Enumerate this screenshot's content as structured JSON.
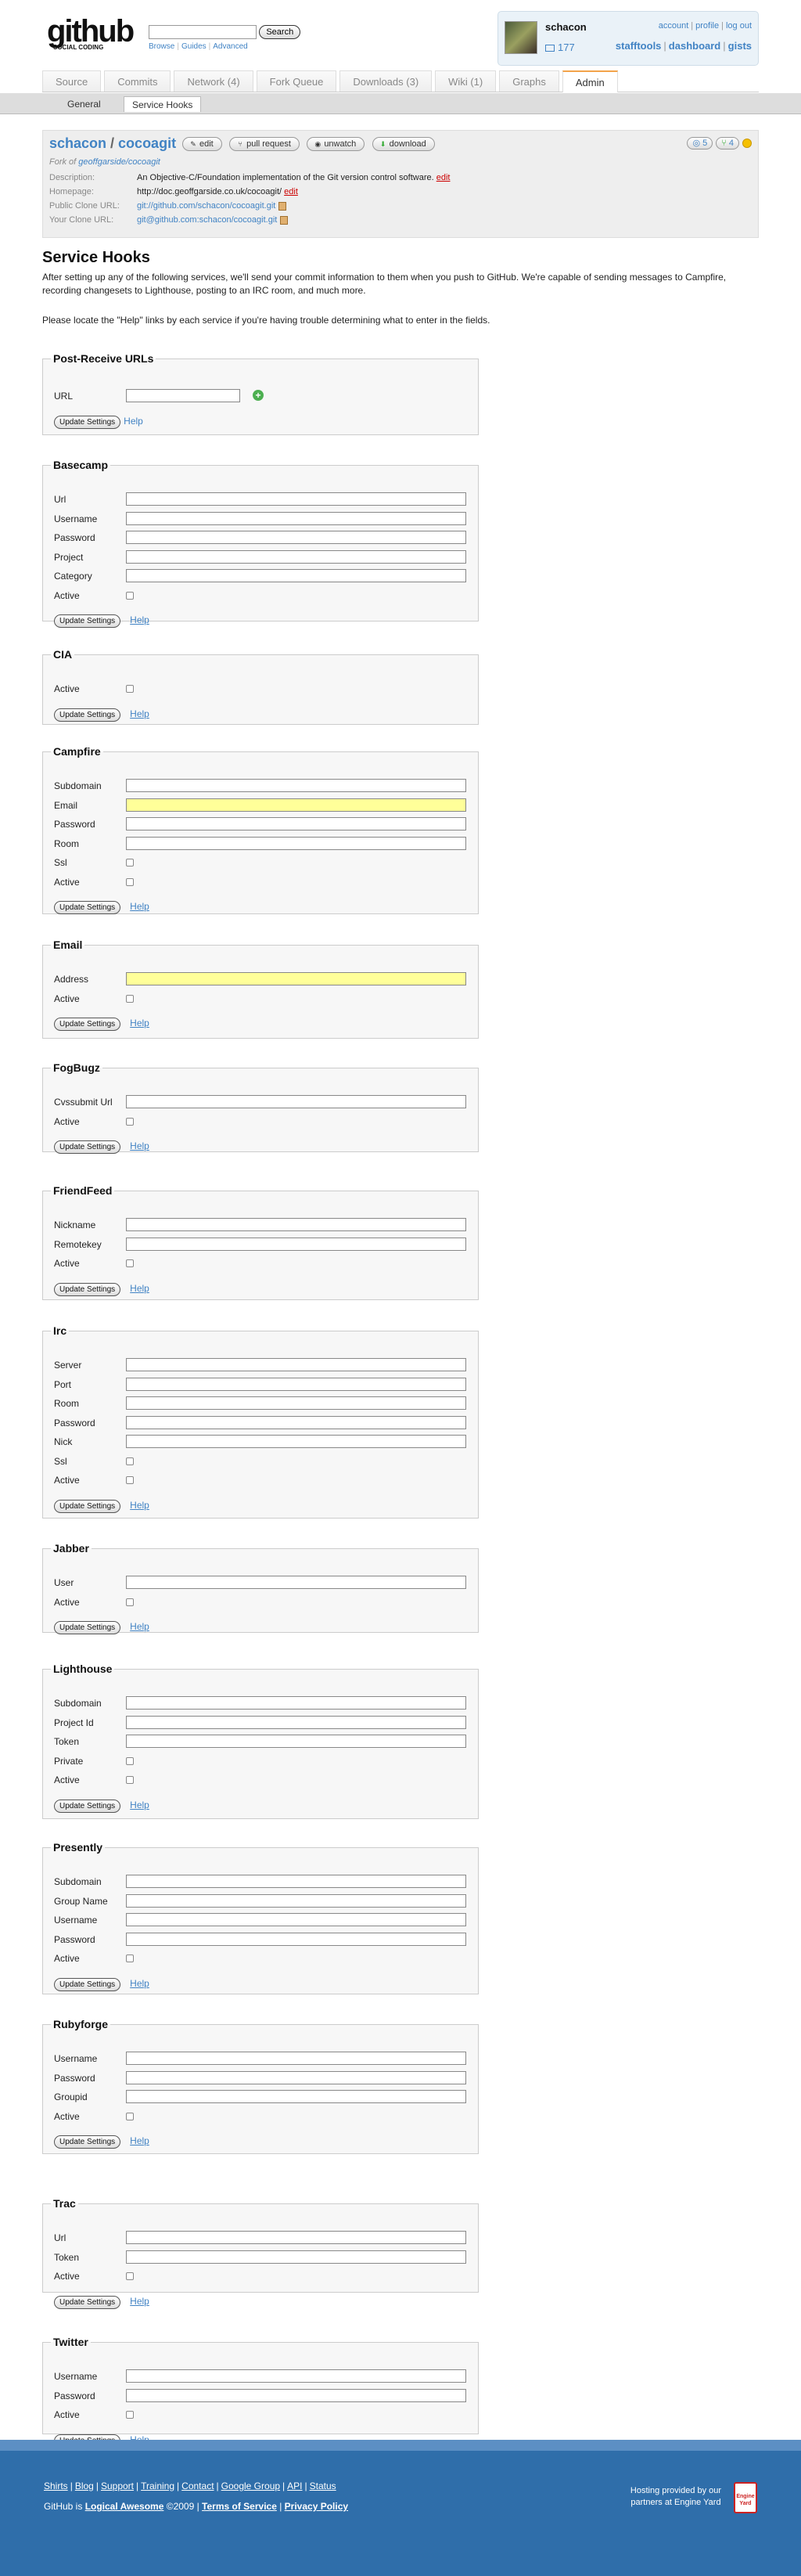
{
  "header": {
    "logo_big": "github",
    "logo_small": "SOCIAL CODING",
    "search_button": "Search",
    "search_links": [
      "Browse",
      "Guides",
      "Advanced"
    ],
    "user": "schacon",
    "message_count": "177",
    "top_links": [
      "account",
      "profile",
      "log out"
    ],
    "bottom_links": [
      "stafftools",
      "dashboard",
      "gists"
    ]
  },
  "tabs": [
    "Source",
    "Commits",
    "Network (4)",
    "Fork Queue",
    "Downloads (3)",
    "Wiki (1)",
    "Graphs",
    "Admin"
  ],
  "subtabs": [
    "General",
    "Service Hooks"
  ],
  "repo": {
    "owner": "schacon",
    "slash": " / ",
    "name": "cocoagit",
    "buttons": [
      "edit",
      "pull request",
      "unwatch",
      "download"
    ],
    "watchers": "5",
    "forks": "4",
    "fork_prefix": "Fork of ",
    "fork_of": "geoffgarside/cocoagit",
    "description_label": "Description:",
    "description": "An Objective-C/Foundation implementation of the Git version control software.",
    "homepage_label": "Homepage:",
    "homepage": "http://doc.geoffgarside.co.uk/cocoagit/",
    "edit": "edit",
    "public_clone_label": "Public Clone URL:",
    "public_clone": "git://github.com/schacon/cocoagit.git",
    "your_clone_label": "Your Clone URL:",
    "your_clone": "git@github.com:schacon/cocoagit.git"
  },
  "service_hooks": {
    "title": "Service Hooks",
    "intro": "After setting up any of the following services, we'll send your commit information to them when you push to GitHub. We're capable of sending messages to Campfire, recording changesets to Lighthouse, posting to an IRC room, and much more.",
    "note": "Please locate the \"Help\" links by each service if you're having trouble determining what to enter in the fields.",
    "update_label": "Update Settings",
    "help_label": "Help"
  },
  "services": [
    {
      "name": "Post-Receive URLs",
      "fields": [
        {
          "label": "URL",
          "type": "url"
        }
      ]
    },
    {
      "name": "Basecamp",
      "fields": [
        {
          "label": "Url",
          "type": "text"
        },
        {
          "label": "Username",
          "type": "text"
        },
        {
          "label": "Password",
          "type": "text"
        },
        {
          "label": "Project",
          "type": "text"
        },
        {
          "label": "Category",
          "type": "text"
        },
        {
          "label": "Active",
          "type": "check"
        }
      ]
    },
    {
      "name": "CIA",
      "fields": [
        {
          "label": "Active",
          "type": "check"
        }
      ]
    },
    {
      "name": "Campfire",
      "fields": [
        {
          "label": "Subdomain",
          "type": "text"
        },
        {
          "label": "Email",
          "type": "text",
          "hl": true
        },
        {
          "label": "Password",
          "type": "text"
        },
        {
          "label": "Room",
          "type": "text"
        },
        {
          "label": "Ssl",
          "type": "check"
        },
        {
          "label": "Active",
          "type": "check"
        }
      ]
    },
    {
      "name": "Email",
      "fields": [
        {
          "label": "Address",
          "type": "text",
          "hl": true
        },
        {
          "label": "Active",
          "type": "check"
        }
      ]
    },
    {
      "name": "FogBugz",
      "fields": [
        {
          "label": "Cvssubmit Url",
          "type": "text"
        },
        {
          "label": "Active",
          "type": "check"
        }
      ]
    },
    {
      "name": "FriendFeed",
      "fields": [
        {
          "label": "Nickname",
          "type": "text"
        },
        {
          "label": "Remotekey",
          "type": "text"
        },
        {
          "label": "Active",
          "type": "check"
        }
      ]
    },
    {
      "name": "Irc",
      "fields": [
        {
          "label": "Server",
          "type": "text"
        },
        {
          "label": "Port",
          "type": "text"
        },
        {
          "label": "Room",
          "type": "text"
        },
        {
          "label": "Password",
          "type": "text"
        },
        {
          "label": "Nick",
          "type": "text"
        },
        {
          "label": "Ssl",
          "type": "check"
        },
        {
          "label": "Active",
          "type": "check"
        }
      ]
    },
    {
      "name": "Jabber",
      "fields": [
        {
          "label": "User",
          "type": "text"
        },
        {
          "label": "Active",
          "type": "check"
        }
      ]
    },
    {
      "name": "Lighthouse",
      "fields": [
        {
          "label": "Subdomain",
          "type": "text"
        },
        {
          "label": "Project Id",
          "type": "text"
        },
        {
          "label": "Token",
          "type": "text"
        },
        {
          "label": "Private",
          "type": "check"
        },
        {
          "label": "Active",
          "type": "check"
        }
      ]
    },
    {
      "name": "Presently",
      "fields": [
        {
          "label": "Subdomain",
          "type": "text"
        },
        {
          "label": "Group Name",
          "type": "text"
        },
        {
          "label": "Username",
          "type": "text"
        },
        {
          "label": "Password",
          "type": "text"
        },
        {
          "label": "Active",
          "type": "check"
        }
      ]
    },
    {
      "name": "Rubyforge",
      "fields": [
        {
          "label": "Username",
          "type": "text"
        },
        {
          "label": "Password",
          "type": "text"
        },
        {
          "label": "Groupid",
          "type": "text"
        },
        {
          "label": "Active",
          "type": "check"
        }
      ]
    },
    {
      "name": "Trac",
      "fields": [
        {
          "label": "Url",
          "type": "text"
        },
        {
          "label": "Token",
          "type": "text"
        },
        {
          "label": "Active",
          "type": "check"
        }
      ]
    },
    {
      "name": "Twitter",
      "fields": [
        {
          "label": "Username",
          "type": "text"
        },
        {
          "label": "Password",
          "type": "text"
        },
        {
          "label": "Active",
          "type": "check"
        }
      ]
    }
  ],
  "footer": {
    "links": [
      "Shirts",
      "Blog",
      "Support",
      "Training",
      "Contact",
      "Google Group",
      "API",
      "Status"
    ],
    "github_is": "GitHub is ",
    "logical_awesome": "Logical Awesome",
    "copyright": " ©2009 | ",
    "terms": "Terms of Service",
    "privacy": "Privacy Policy",
    "hosting": "Hosting provided by our partners at Engine Yard",
    "ey_badge": "Engine Yard"
  }
}
